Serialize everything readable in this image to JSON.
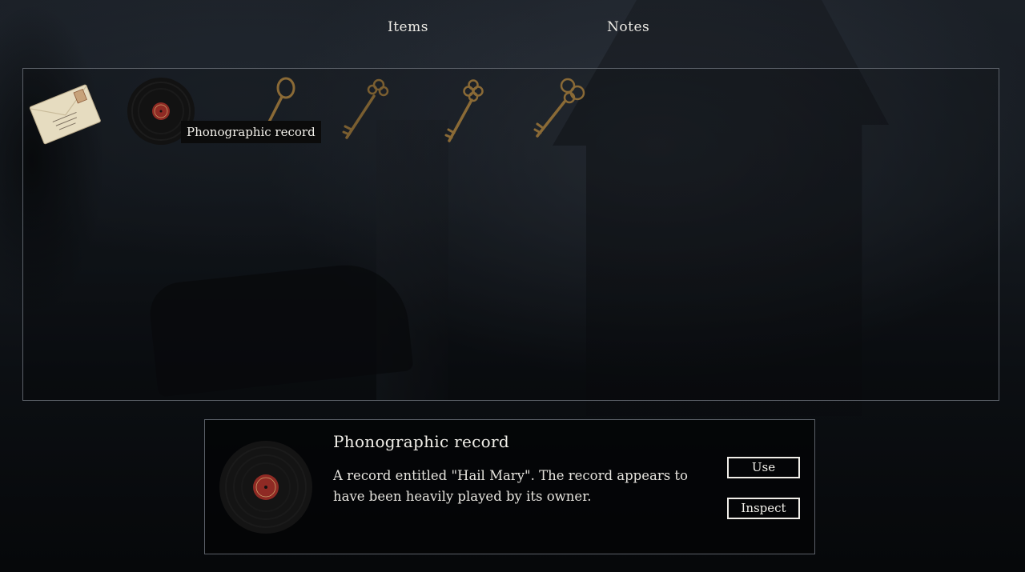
{
  "tabs": [
    {
      "label": "Items",
      "active": true
    },
    {
      "label": "Notes",
      "active": false
    }
  ],
  "inventory": {
    "items": [
      {
        "name": "letter",
        "icon": "letter-envelope-icon"
      },
      {
        "name": "phonographic record",
        "icon": "phonograph-record-icon"
      },
      {
        "name": "key oval",
        "icon": "oval-key-icon"
      },
      {
        "name": "key ornate",
        "icon": "ornate-key-icon"
      },
      {
        "name": "key clover",
        "icon": "clover-key-icon"
      },
      {
        "name": "key trefoil",
        "icon": "trefoil-key-icon"
      }
    ],
    "hover_tooltip": "Phonographic record"
  },
  "detail": {
    "title": "Phonographic record",
    "description": "A record entitled \"Hail Mary\". The record appears to have been heavily played by its owner.",
    "buttons": {
      "use": "Use",
      "inspect": "Inspect"
    }
  },
  "colors": {
    "border": "#5b6068",
    "text": "#f2f0ea",
    "record_label": "#8f2a24",
    "key_brass": "#8a6a36"
  }
}
